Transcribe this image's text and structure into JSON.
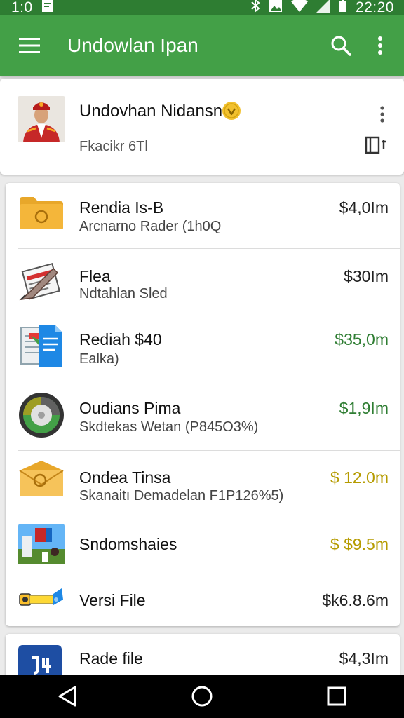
{
  "status_bar": {
    "left_text": "1:0",
    "time": "22:20",
    "icons": [
      "notification-icon",
      "bluetooth-icon",
      "image-icon",
      "wifi-icon",
      "signal-icon",
      "battery-icon"
    ]
  },
  "app_bar": {
    "title": "Undowlan Ipan",
    "icons": [
      "menu-icon",
      "search-icon",
      "more-vert-icon"
    ]
  },
  "profile": {
    "name": "Undovhan Nidansn",
    "subtitle": "Fkacikr 6Tl",
    "badge_icon": "verified-badge-icon",
    "menu_icon": "more-vert-icon",
    "action_icon": "add-to-list-icon"
  },
  "files": [
    {
      "title": "Rendia Is-B",
      "subtitle": "Arcnarno Rader (1h0Q",
      "price": "$4,0Im",
      "price_color": "#212121",
      "icon": "folder-icon"
    },
    {
      "title": "Flea",
      "subtitle": "Ndtahlan Sled",
      "price": "$30Im",
      "price_color": "#212121",
      "icon": "document-pen-icon"
    },
    {
      "title": "Rediah $40",
      "subtitle": "Ealka)",
      "price": "$35,0m",
      "price_color": "#2e7d32",
      "icon": "docs-icon"
    },
    {
      "title": "Oudians Pima",
      "subtitle": "Skdtekas Wetan (P845O3%)",
      "price": "$1,9Im",
      "price_color": "#2e7d32",
      "icon": "disc-icon"
    },
    {
      "title": "Ondea Tinsa",
      "subtitle": "Skanaitı Demadelan F1P126%5)",
      "price": "$ 12.0m",
      "price_color": "#b59b00",
      "icon": "envelope-icon"
    },
    {
      "title": "Sndomshaies",
      "subtitle": "",
      "price": "$ $9.5m",
      "price_color": "#b59b00",
      "icon": "photo-icon"
    },
    {
      "title": "Versi File",
      "subtitle": "",
      "price": "$k6.8.6m",
      "price_color": "#212121",
      "icon": "usb-drive-icon"
    }
  ],
  "bottom_file": {
    "title": "Rade file",
    "price": "$4,3Im",
    "icon": "blue-app-icon"
  },
  "nav": {
    "icons": [
      "back-icon",
      "home-icon",
      "recents-icon"
    ]
  },
  "colors": {
    "primary": "#43a047",
    "status": "#2e7d32",
    "green_price": "#2e7d32",
    "gold_price": "#b59b00"
  }
}
